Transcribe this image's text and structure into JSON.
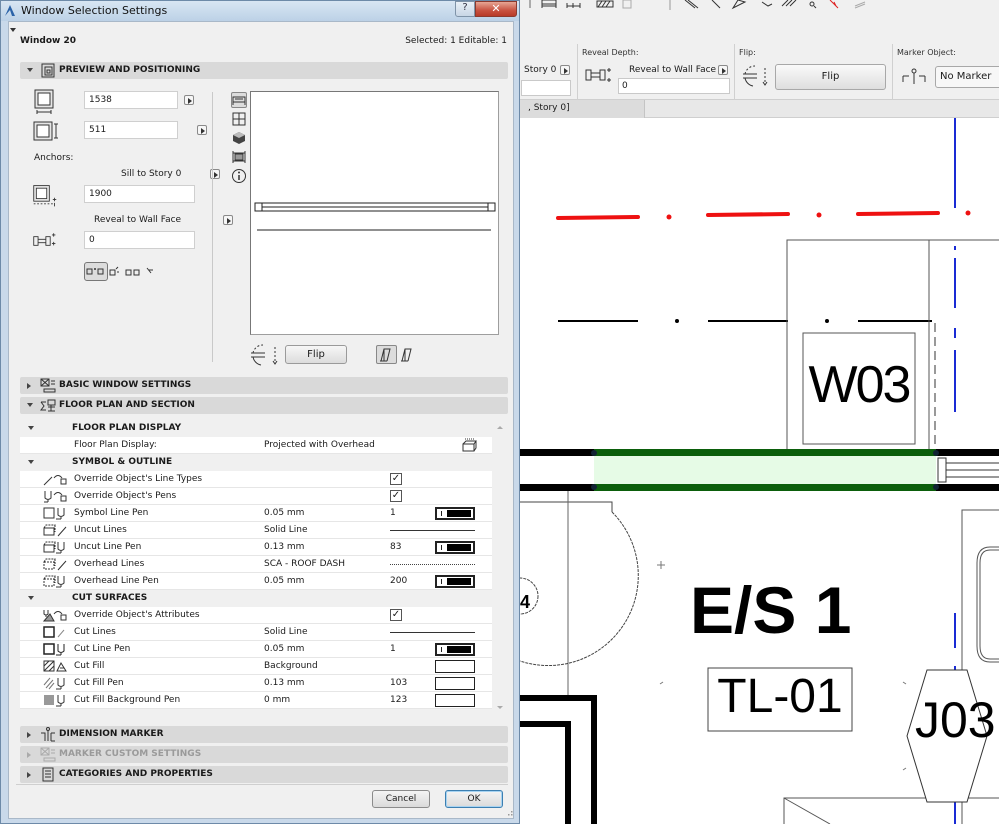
{
  "dialog": {
    "title": "Window Selection Settings",
    "help_label": "?",
    "close_label": "✕",
    "element_name": "Window 20",
    "selection_info": "Selected: 1 Editable: 1",
    "cancel_label": "Cancel",
    "ok_label": "OK"
  },
  "panels": {
    "preview": {
      "title": "PREVIEW AND POSITIONING",
      "expanded": true,
      "icon": "preview-panel-icon"
    },
    "basic": {
      "title": "BASIC WINDOW SETTINGS",
      "expanded": false,
      "icon": "window-settings-icon"
    },
    "floorplan": {
      "title": "FLOOR PLAN AND SECTION",
      "expanded": true,
      "icon": "floor-plan-section-icon"
    },
    "dimension": {
      "title": "DIMENSION MARKER",
      "expanded": false,
      "icon": "dimension-marker-icon"
    },
    "marker_custom": {
      "title": "MARKER CUSTOM SETTINGS",
      "expanded": false,
      "disabled": true,
      "icon": "marker-custom-icon"
    },
    "categories": {
      "title": "CATEGORIES AND PROPERTIES",
      "expanded": false,
      "icon": "categories-icon"
    }
  },
  "preview": {
    "width_value": "1538",
    "height_value": "511",
    "anchors_label": "Anchors:",
    "sill_label": "Sill to Story 0",
    "sill_value": "1900",
    "reveal_label": "Reveal to Wall Face",
    "reveal_value": "0",
    "flip_label": "Flip",
    "view_icons": [
      "floor-plan-view-icon",
      "front-view-icon",
      "3d-view-icon",
      "side-view-icon",
      "info-icon"
    ]
  },
  "floor_plan_table": {
    "groups": [
      {
        "title": "FLOOR PLAN DISPLAY",
        "rows": [
          {
            "label": "Floor Plan Display:",
            "value": "Projected with Overhead",
            "control": "display-icon"
          }
        ]
      },
      {
        "title": "SYMBOL & OUTLINE",
        "rows": [
          {
            "label": "Override Object's Line Types",
            "control": "checkbox",
            "checked": true
          },
          {
            "label": "Override Object's Pens",
            "control": "checkbox",
            "checked": true
          },
          {
            "label": "Symbol Line Pen",
            "value": "0.05 mm",
            "number": "1",
            "control": "pen"
          },
          {
            "label": "Uncut Lines",
            "value": "Solid Line",
            "control": "solid-line"
          },
          {
            "label": "Uncut Line Pen",
            "value": "0.13 mm",
            "number": "83",
            "control": "pen"
          },
          {
            "label": "Overhead Lines",
            "value": "SCA - ROOF DASH",
            "control": "dashed-line"
          },
          {
            "label": "Overhead Line Pen",
            "value": "0.05 mm",
            "number": "200",
            "control": "pen"
          }
        ]
      },
      {
        "title": "CUT SURFACES",
        "rows": [
          {
            "label": "Override Object's Attributes",
            "control": "checkbox",
            "checked": true
          },
          {
            "label": "Cut Lines",
            "value": "Solid Line",
            "control": "solid-line"
          },
          {
            "label": "Cut Line Pen",
            "value": "0.05 mm",
            "number": "1",
            "control": "pen"
          },
          {
            "label": "Cut Fill",
            "value": "Background",
            "control": "empty"
          },
          {
            "label": "Cut Fill Pen",
            "value": "0.13 mm",
            "number": "103",
            "control": "empty"
          },
          {
            "label": "Cut Fill Background Pen",
            "value": "0 mm",
            "number": "123",
            "control": "empty"
          }
        ]
      }
    ]
  },
  "infobox": {
    "story_label": "Story 0",
    "reveal_depth_label": "Reveal Depth:",
    "reveal_mode": "Reveal to Wall Face",
    "reveal_value": "0",
    "flip_label": "Flip:",
    "flip_button": "Flip",
    "marker_label": "Marker Object:",
    "marker_value": "No Marker"
  },
  "view_tab": {
    "label": ", Story 0]"
  },
  "drawing": {
    "window_tag": "W03",
    "zone_name": "E/S 1",
    "zone_code": "TL-01",
    "hex_tag": "J03",
    "colors": {
      "selection_fill": "#e6fbe6",
      "selection_edge": "#0b5e0b",
      "axis_red": "#ee1111",
      "grid_blue": "#1a2bd4"
    }
  }
}
